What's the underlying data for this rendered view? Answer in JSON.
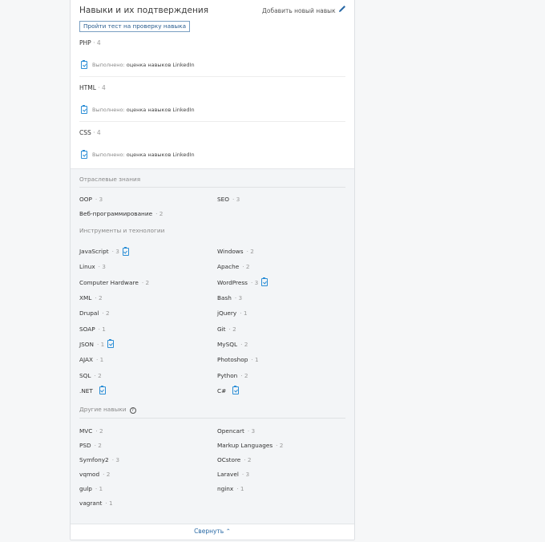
{
  "header": {
    "title": "Навыки и их подтверждения",
    "add_label": "Добавить новый навык",
    "test_button": "Пройти тест на проверку навыка"
  },
  "top_skills": [
    {
      "name": "PHP",
      "count": "· 4",
      "verified_prefix": "Выполнено:",
      "verified_text": "оценка навыков LinkedIn"
    },
    {
      "name": "HTML",
      "count": "· 4",
      "verified_prefix": "Выполнено:",
      "verified_text": "оценка навыков LinkedIn"
    },
    {
      "name": "CSS",
      "count": "· 4",
      "verified_prefix": "Выполнено:",
      "verified_text": "оценка навыков LinkedIn"
    }
  ],
  "sections": [
    {
      "title": "Отраслевые знания",
      "items": [
        {
          "name": "OOP",
          "count": "· 3"
        },
        {
          "name": "SEO",
          "count": "· 3"
        },
        {
          "name": "Веб-программирование",
          "count": "· 2"
        }
      ]
    },
    {
      "title": "Инструменты и технологии",
      "items": [
        {
          "name": "JavaScript",
          "count": "· 3",
          "verified": true
        },
        {
          "name": "Windows",
          "count": "· 2"
        },
        {
          "name": "Linux",
          "count": "· 3"
        },
        {
          "name": "Apache",
          "count": "· 2"
        },
        {
          "name": "Computer Hardware",
          "count": "· 2"
        },
        {
          "name": "WordPress",
          "count": "· 3",
          "verified": true
        },
        {
          "name": "XML",
          "count": "· 2"
        },
        {
          "name": "Bash",
          "count": "· 3"
        },
        {
          "name": "Drupal",
          "count": "· 2"
        },
        {
          "name": "jQuery",
          "count": "· 1"
        },
        {
          "name": "SOAP",
          "count": "· 1"
        },
        {
          "name": "Git",
          "count": "· 2"
        },
        {
          "name": "JSON",
          "count": "· 1",
          "verified": true
        },
        {
          "name": "MySQL",
          "count": "· 2"
        },
        {
          "name": "AJAX",
          "count": "· 1"
        },
        {
          "name": "Photoshop",
          "count": "· 1"
        },
        {
          "name": "SQL",
          "count": "· 2"
        },
        {
          "name": "Python",
          "count": "· 2"
        },
        {
          "name": ".NET",
          "count": "",
          "verified": true
        },
        {
          "name": "C#",
          "count": "",
          "verified": true
        }
      ]
    },
    {
      "title": "Другие навыки",
      "items": [
        {
          "name": "MVC",
          "count": "· 2"
        },
        {
          "name": "Opencart",
          "count": "· 3"
        },
        {
          "name": "PSD",
          "count": "· 2"
        },
        {
          "name": "Markup Languages",
          "count": "· 2"
        },
        {
          "name": "Symfony2",
          "count": "· 3"
        },
        {
          "name": "OCstore",
          "count": "· 2"
        },
        {
          "name": "vqmod",
          "count": "· 2"
        },
        {
          "name": "Laravel",
          "count": "· 3"
        },
        {
          "name": "gulp",
          "count": "· 1"
        },
        {
          "name": "nginx",
          "count": "· 1"
        },
        {
          "name": "vagrant",
          "count": "· 1"
        }
      ]
    }
  ],
  "footer": {
    "collapse_label": "Свернуть"
  },
  "colors": {
    "accent": "#2b8ed6",
    "link": "#2a6aa6"
  }
}
